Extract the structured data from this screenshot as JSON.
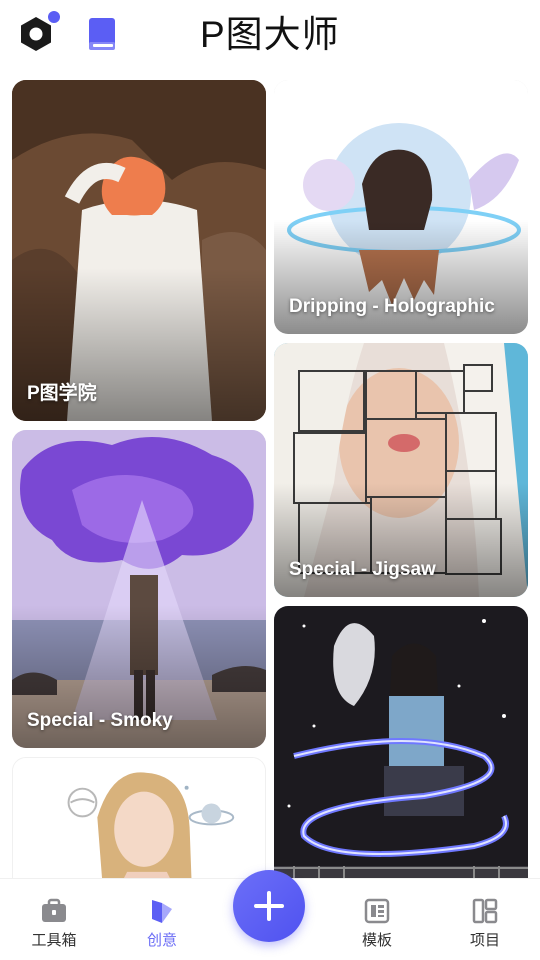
{
  "header": {
    "title": "P图大师",
    "logo_icon": "hexagon-logo-icon",
    "guide_icon": "book-icon",
    "notification_color": "#5b5ef4"
  },
  "feed": {
    "cards": [
      {
        "label": "P图学院"
      },
      {
        "label": "Dripping - Holographic"
      },
      {
        "label": "Special - Smoky"
      },
      {
        "label": "Special - Jigsaw"
      },
      {
        "label": ""
      },
      {
        "label": ""
      }
    ]
  },
  "bottom_nav": {
    "items": [
      {
        "label": "工具箱",
        "icon": "toolbox-icon"
      },
      {
        "label": "创意",
        "icon": "creative-icon",
        "active": true
      },
      {
        "label": "模板",
        "icon": "template-icon"
      },
      {
        "label": "项目",
        "icon": "projects-icon"
      }
    ],
    "fab_icon": "plus-icon",
    "accent": "#6a6cf6"
  }
}
